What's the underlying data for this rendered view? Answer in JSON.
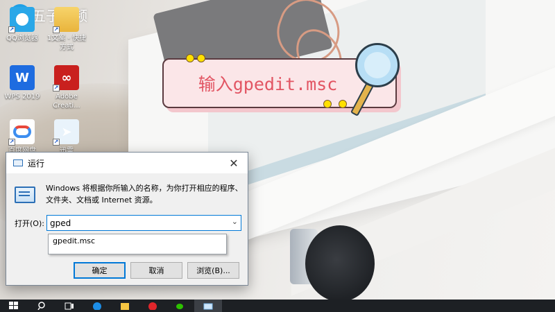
{
  "watermark": {
    "text": "五子视频"
  },
  "desktop_icons": [
    {
      "label": "QQ浏览器",
      "icon": "qq-browser-icon"
    },
    {
      "label": "1文案 - 快捷\n方式",
      "icon": "folder-icon"
    },
    {
      "label": "WPS 2019",
      "icon": "wps-icon"
    },
    {
      "label": "Adobe\nCreati...",
      "icon": "adobe-icon"
    },
    {
      "label": "百度网盘",
      "icon": "baidu-netdisk-icon"
    },
    {
      "label": "迅雷",
      "icon": "xunlei-icon"
    }
  ],
  "banner": {
    "text": "输入gpedit.msc"
  },
  "run_dialog": {
    "title": "运行",
    "description": "Windows 将根据你所输入的名称，为你打开相应的程序、文件夹、文档或 Internet 资源。",
    "open_label": "打开(O):",
    "input_value": "gped",
    "suggestion": "gpedit.msc",
    "ok_label": "确定",
    "cancel_label": "取消",
    "browse_label": "浏览(B)..."
  },
  "taskbar": {
    "items": [
      "start-icon",
      "search-icon",
      "task-view-icon",
      "browser-icon",
      "file-explorer-icon",
      "netease-music-icon",
      "wechat-icon",
      "run-icon"
    ]
  },
  "colors": {
    "banner_text": "#e25563",
    "accent": "#0078d7"
  }
}
